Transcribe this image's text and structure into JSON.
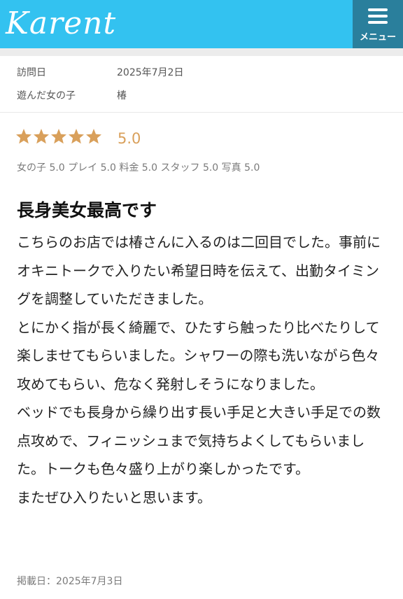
{
  "header": {
    "logo_text": "Karent",
    "menu_label": "メニュー"
  },
  "visit": {
    "date_label": "訪問日",
    "date_value": "2025年7月2日",
    "girl_label": "遊んだ女の子",
    "girl_value": "椿"
  },
  "rating": {
    "stars": 5,
    "score": "5.0",
    "star_color": "#d9a05b",
    "sub_scores": "女の子 5.0 プレイ 5.0 料金 5.0 スタッフ 5.0 写真 5.0"
  },
  "review": {
    "title": "長身美女最高です",
    "paragraphs": [
      "こちらのお店では椿さんに入るのは二回目でした。事前にオキニトークで入りたい希望日時を伝えて、出勤タイミングを調整していただきました。",
      "とにかく指が長く綺麗で、ひたすら触ったり比べたりして楽しませてもらいました。シャワーの際も洗いながら色々攻めてもらい、危なく発射しそうになりました。",
      "ベッドでも長身から繰り出す長い手足と大きい手足での数点攻めで、フィニッシュまで気持ちよくしてもらいました。トークも色々盛り上がり楽しかったです。",
      "またぜひ入りたいと思います。"
    ],
    "posted": "掲載日：2025年7月3日"
  },
  "colors": {
    "header_bg": "#33c2f0",
    "menu_bg": "#2a7f9c",
    "accent": "#d9a05b"
  }
}
